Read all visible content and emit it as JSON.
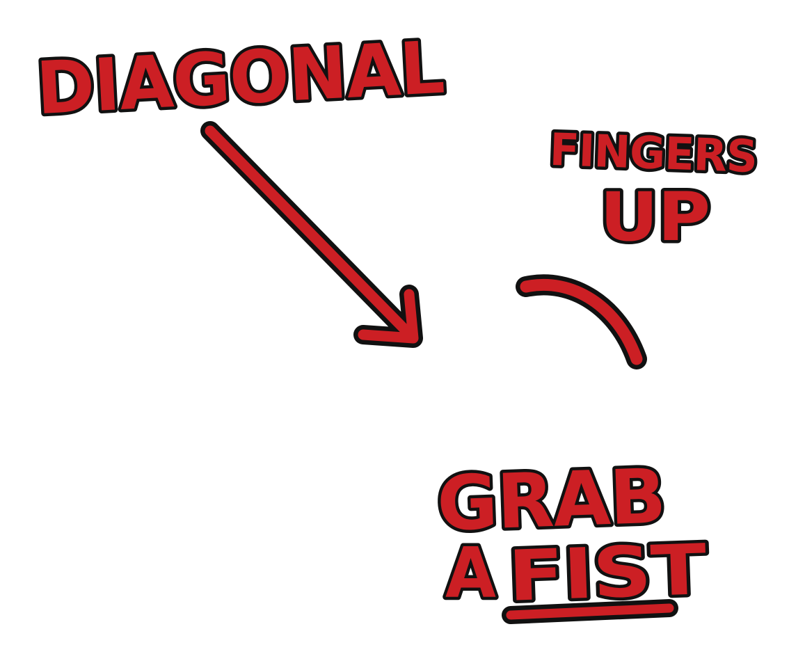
{
  "labels": {
    "diagonal": "DIAGONAL",
    "fingers": "FINGERS",
    "up": "UP",
    "grab": "GRAB",
    "a": "A",
    "fist": "FIST"
  },
  "colors": {
    "red": "#cc1f24",
    "outline": "#111111",
    "background": "#ffffff"
  }
}
